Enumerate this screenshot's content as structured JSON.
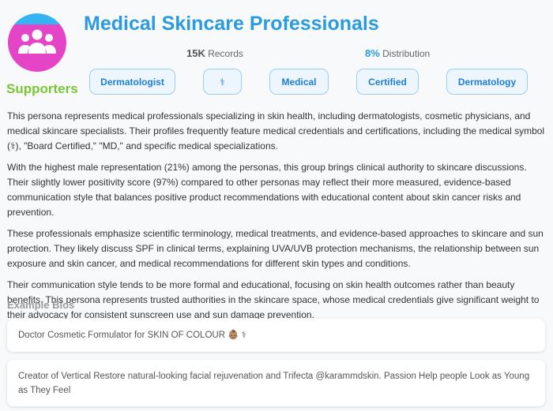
{
  "persona": {
    "title": "Medical Skincare Professionals",
    "segment": "Supporters",
    "icon": "people-group-icon",
    "avatar_colors": {
      "top": "#36b3f1",
      "bottom": "#e544c6"
    }
  },
  "stats": {
    "records_value": "15K",
    "records_label": "Records",
    "distribution_value": "8%",
    "distribution_label": "Distribution"
  },
  "tags": [
    "Dermatologist",
    "⚕",
    "Medical",
    "Certified",
    "Dermatology"
  ],
  "description": [
    "This persona represents medical professionals specializing in skin health, including dermatologists, cosmetic physicians, and medical skincare specialists. Their profiles frequently feature medical credentials and certifications, including the medical symbol (⚕), \"Board Certified,\" \"MD,\" and specific medical specializations.",
    "With the highest male representation (21%) among the personas, this group brings clinical authority to skincare discussions. Their slightly lower positivity score (97%) compared to other personas may reflect their more measured, evidence-based communication style that balances positive product recommendations with educational content about skin cancer risks and prevention.",
    "These professionals emphasize scientific terminology, medical treatments, and evidence-based approaches to skincare and sun protection. They likely discuss SPF in clinical terms, explaining UVA/UVB protection mechanisms, the relationship between sun exposure and skin cancer, and medical recommendations for different skin types and conditions.",
    "Their communication style tends to be more formal and educational, focusing on skin health outcomes rather than beauty benefits. This persona represents trusted authorities in the skincare space, whose medical credentials give significant weight to their advocacy for consistent sunscreen use and sun damage prevention."
  ],
  "examples": {
    "title": "Example Bios",
    "bios": [
      "Doctor Cosmetic Formulator for SKIN OF COLOUR 👶🏽 ⚕",
      "Creator of Vertical Restore natural-looking facial rejuvenation and Trifecta @karammdskin. Passion Help people Look as Young as They Feel"
    ]
  },
  "colors": {
    "title": "#2b9be0",
    "segment": "#7ac734",
    "tag_text": "#1f7ed0",
    "tag_border": "#9ccdf0"
  }
}
